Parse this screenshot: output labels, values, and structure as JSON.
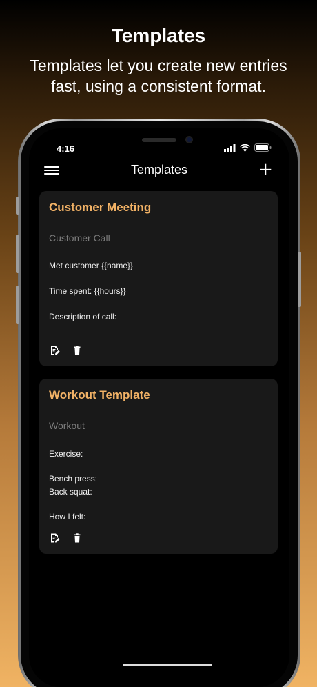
{
  "promo": {
    "headline": "Templates",
    "subline": "Templates let you create new entries fast, using a consistent format."
  },
  "status_bar": {
    "time": "4:16",
    "icons": [
      "cellular-icon",
      "wifi-icon",
      "battery-icon"
    ]
  },
  "nav": {
    "title": "Templates",
    "menu_icon": "hamburger-menu-icon",
    "add_icon": "plus-icon",
    "add_label": "+"
  },
  "templates": [
    {
      "title": "Customer Meeting",
      "subtitle": "Customer Call",
      "lines": [
        "Met customer {{name}}",
        "Time spent: {{hours}}",
        "Description of call:"
      ],
      "actions": [
        "edit-icon",
        "delete-icon"
      ]
    },
    {
      "title": "Workout Template",
      "subtitle": "Workout",
      "lines": [
        "Exercise:",
        "Bench press:",
        "Back squat:",
        "How I felt:"
      ],
      "actions": [
        "edit-icon",
        "delete-icon"
      ]
    }
  ],
  "colors": {
    "accent": "#f2b266",
    "card_background": "#191919",
    "screen_background": "#000000"
  }
}
